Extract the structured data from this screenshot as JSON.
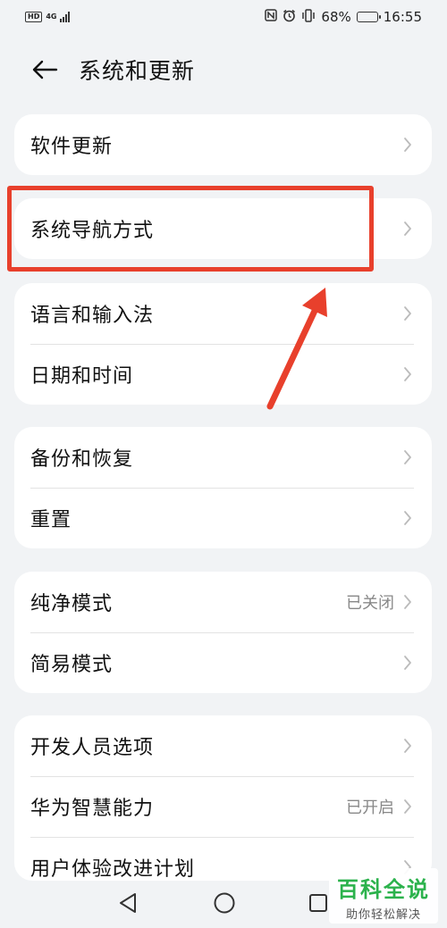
{
  "status_bar": {
    "hd_badge": "HD",
    "network": "4G",
    "battery_percent": "68%",
    "battery_level": 0.68,
    "time": "16:55",
    "icons": [
      "nfc-icon",
      "alarm-icon",
      "vibrate-icon",
      "battery-icon"
    ]
  },
  "header": {
    "title": "系统和更新",
    "back_icon": "arrow-left-icon"
  },
  "groups": [
    {
      "items": [
        {
          "label": "软件更新",
          "value": ""
        }
      ]
    },
    {
      "items": [
        {
          "label": "系统导航方式",
          "value": ""
        }
      ]
    },
    {
      "items": [
        {
          "label": "语言和输入法",
          "value": ""
        },
        {
          "label": "日期和时间",
          "value": ""
        }
      ]
    },
    {
      "items": [
        {
          "label": "备份和恢复",
          "value": ""
        },
        {
          "label": "重置",
          "value": ""
        }
      ]
    },
    {
      "items": [
        {
          "label": "纯净模式",
          "value": "已关闭"
        },
        {
          "label": "简易模式",
          "value": ""
        }
      ]
    },
    {
      "items": [
        {
          "label": "开发人员选项",
          "value": ""
        },
        {
          "label": "华为智慧能力",
          "value": "已开启"
        },
        {
          "label": "用户体验改进计划",
          "value": ""
        }
      ]
    }
  ],
  "annotation": {
    "color": "#e8402c"
  },
  "nav_bar": {
    "icons": [
      "back-triangle-icon",
      "home-circle-icon",
      "recents-square-icon"
    ]
  },
  "watermark": {
    "main": "百科全说",
    "sub": "助你轻松解决",
    "color": "#2bb24c"
  }
}
